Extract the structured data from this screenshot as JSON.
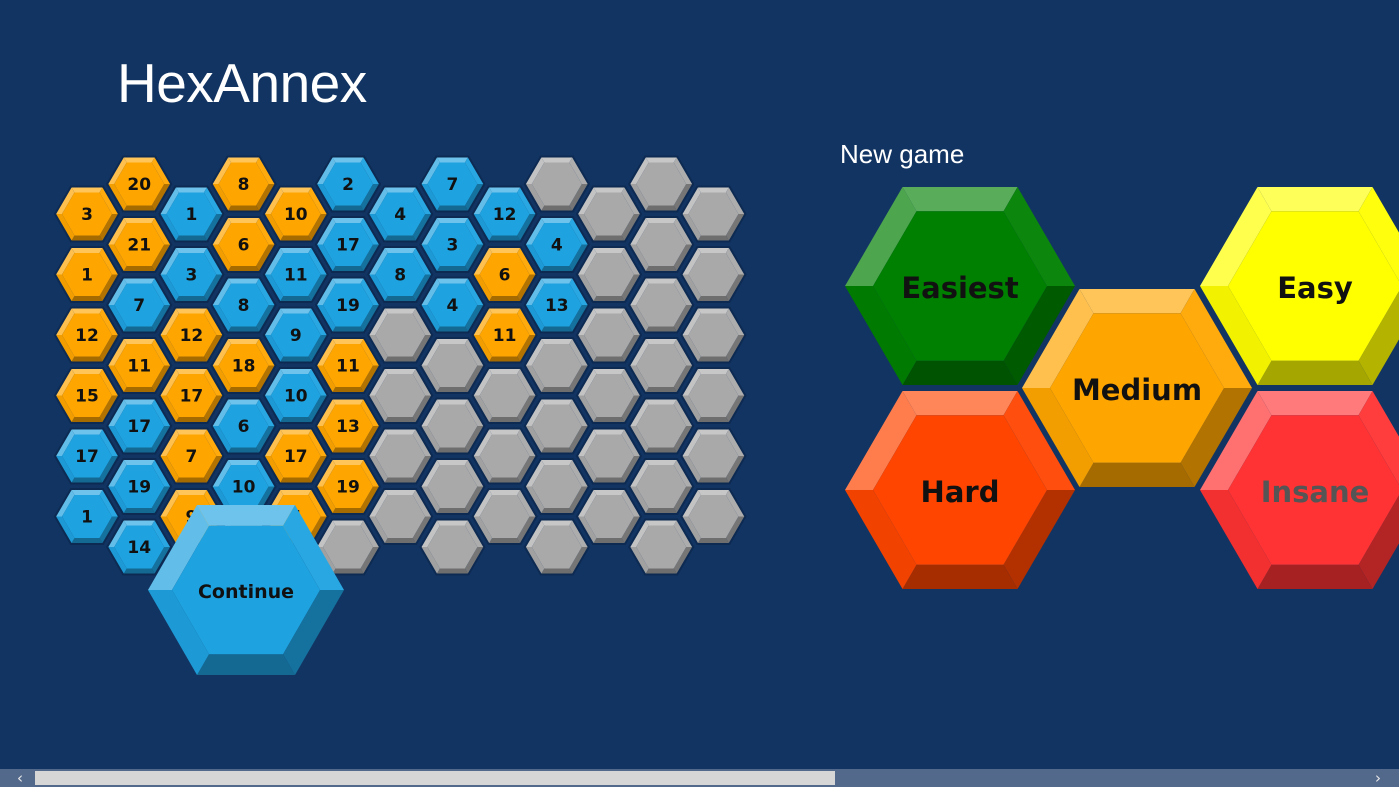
{
  "app": {
    "title": "HexAnnex"
  },
  "new_game": {
    "label": "New game"
  },
  "colors": {
    "background": "#123462",
    "orange": "#ffa500",
    "blue": "#1ea2e0",
    "gray": "#a9a9a9"
  },
  "board": {
    "columns": [
      [
        "o:3",
        "o:1",
        "o:12",
        "o:15",
        "b:17",
        "b:1"
      ],
      [
        "o:20",
        "o:21",
        "b:7",
        "o:11",
        "b:17",
        "b:19",
        "b:14"
      ],
      [
        "b:1",
        "b:3",
        "o:12",
        "o:17",
        "o:7",
        "o:9"
      ],
      [
        "o:8",
        "o:6",
        "b:8",
        "o:18",
        "b:6",
        "b:10",
        "g:"
      ],
      [
        "o:10",
        "b:11",
        "b:9",
        "b:10",
        "o:17",
        "o:4"
      ],
      [
        "b:2",
        "b:17",
        "b:19",
        "o:11",
        "o:13",
        "o:19",
        "g:"
      ],
      [
        "b:4",
        "b:8",
        "g:",
        "g:",
        "g:",
        "g:"
      ],
      [
        "b:7",
        "b:3",
        "b:4",
        "g:",
        "g:",
        "g:",
        "g:"
      ],
      [
        "b:12",
        "o:6",
        "o:11",
        "g:",
        "g:",
        "g:"
      ],
      [
        "g:",
        "b:4",
        "b:13",
        "g:",
        "g:",
        "g:",
        "g:"
      ],
      [
        "g:",
        "g:",
        "g:",
        "g:",
        "g:",
        "g:"
      ],
      [
        "g:",
        "g:",
        "g:",
        "g:",
        "g:",
        "g:",
        "g:"
      ],
      [
        "g:",
        "g:",
        "g:",
        "g:",
        "g:",
        "g:"
      ]
    ]
  },
  "continue_button": {
    "label": "Continue",
    "color": "#1ea2e0"
  },
  "difficulties": [
    {
      "label": "Easiest",
      "color": "#008000",
      "text_color": "#111111"
    },
    {
      "label": "Easy",
      "color": "#ffff00",
      "text_color": "#111111"
    },
    {
      "label": "Medium",
      "color": "#ffa500",
      "text_color": "#111111"
    },
    {
      "label": "Hard",
      "color": "#ff4500",
      "text_color": "#111111"
    },
    {
      "label": "Insane",
      "color": "#ff3333",
      "text_color": "#555555"
    }
  ],
  "scrollbar": {
    "left_arrow": "‹",
    "right_arrow": "›"
  }
}
